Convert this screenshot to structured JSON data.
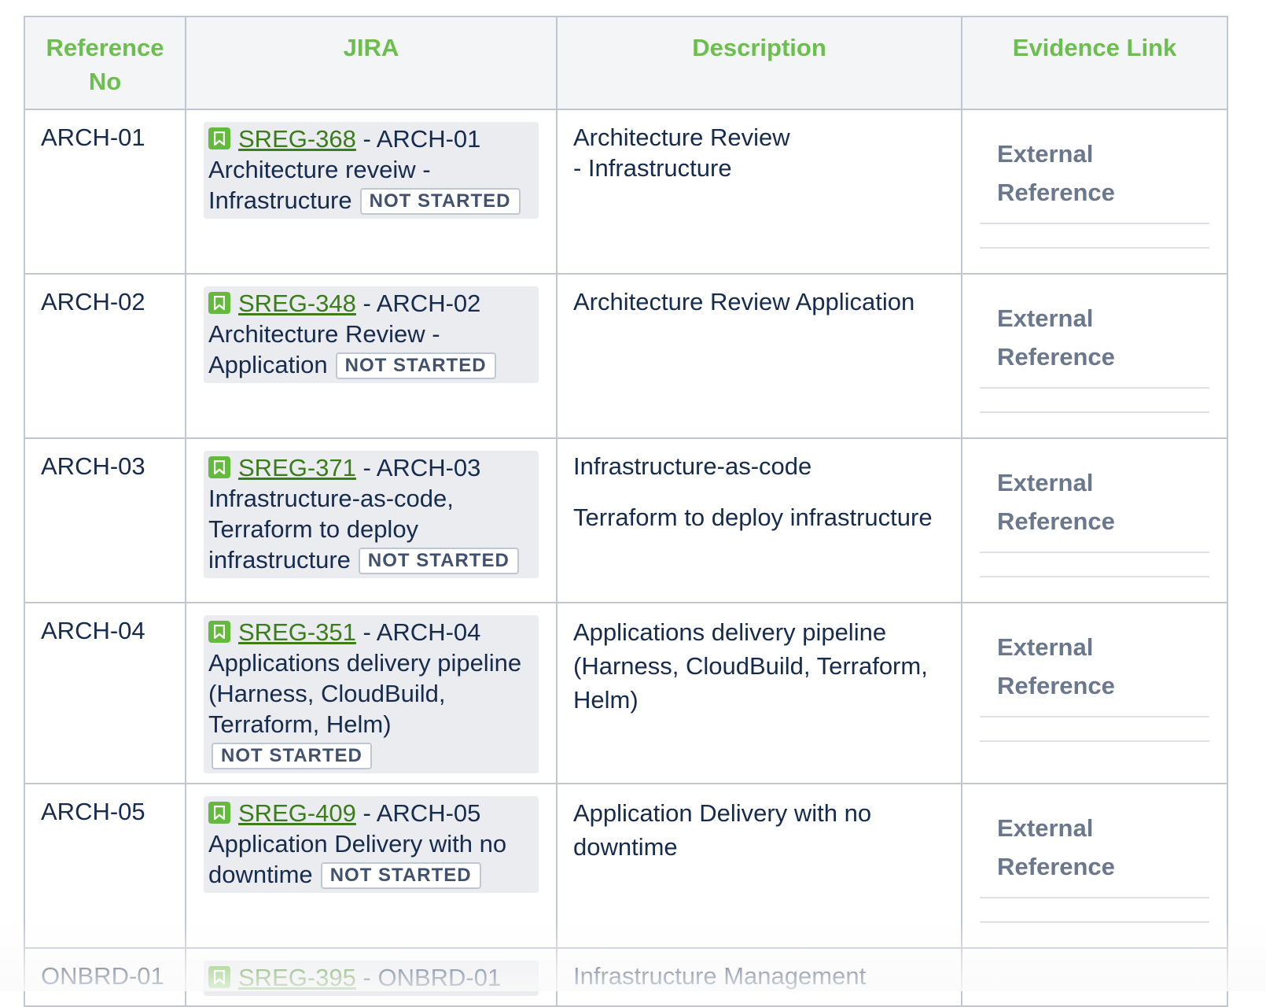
{
  "table": {
    "headers": [
      "Reference No",
      "JIRA",
      "Description",
      "Evidence Link"
    ],
    "rows": [
      {
        "ref": "ARCH-01",
        "jira_key": "SREG-368",
        "jira_summary": " - ARCH-01 Architecture reveiw - Infrastructure",
        "status": "NOT STARTED",
        "description": [
          "Architecture Review",
          "- Infrastructure"
        ],
        "evidence": "External Reference"
      },
      {
        "ref": "ARCH-02",
        "jira_key": "SREG-348",
        "jira_summary": " - ARCH-02 Architecture Review - Application",
        "status": "NOT STARTED",
        "description": [
          "Architecture Review Application"
        ],
        "evidence": "External Reference"
      },
      {
        "ref": "ARCH-03",
        "jira_key": "SREG-371",
        "jira_summary": " - ARCH-03 Infrastructure-as-code, Terraform to deploy infrastructure",
        "status": "NOT STARTED",
        "description": [
          "Infrastructure-as-code",
          "Terraform to deploy infrastructure"
        ],
        "evidence": "External Reference"
      },
      {
        "ref": "ARCH-04",
        "jira_key": "SREG-351",
        "jira_summary": " - ARCH-04 Applications delivery pipeline (Harness, CloudBuild, Terraform, Helm)",
        "status": "NOT STARTED",
        "description": [
          "Applications delivery pipeline (Harness, CloudBuild, Terraform, Helm)"
        ],
        "evidence": "External Reference"
      },
      {
        "ref": "ARCH-05",
        "jira_key": "SREG-409",
        "jira_summary": " - ARCH-05 Application Delivery with no downtime",
        "status": "NOT STARTED",
        "description": [
          "Application Delivery with no downtime"
        ],
        "evidence": "External Reference"
      },
      {
        "ref": "ONBRD-01",
        "jira_key": "SREG-395",
        "jira_summary": " - ONBRD-01",
        "description": [
          "Infrastructure Management"
        ]
      }
    ]
  },
  "colors": {
    "header_text": "#6cbf4f",
    "link": "#3b7c1c",
    "jira_icon": "#63ba3c",
    "evidence_text": "#6b778c",
    "border": "#c1c7d0"
  },
  "icons": {
    "jira_issue": "bookmark-story-icon"
  }
}
